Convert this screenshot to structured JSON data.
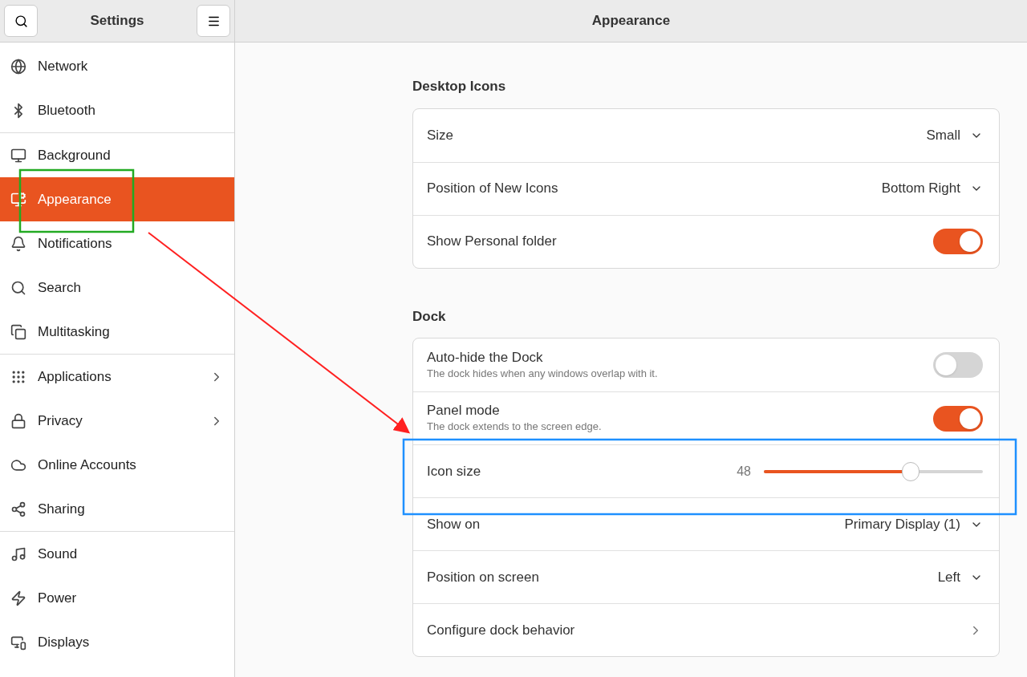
{
  "sidebar": {
    "title": "Settings",
    "groups": [
      {
        "items": [
          {
            "label": "Network",
            "selected": false,
            "submenu": false
          },
          {
            "label": "Bluetooth",
            "selected": false,
            "submenu": false
          }
        ]
      },
      {
        "items": [
          {
            "label": "Background",
            "selected": false,
            "submenu": false
          },
          {
            "label": "Appearance",
            "selected": true,
            "submenu": false
          },
          {
            "label": "Notifications",
            "selected": false,
            "submenu": false
          },
          {
            "label": "Search",
            "selected": false,
            "submenu": false
          },
          {
            "label": "Multitasking",
            "selected": false,
            "submenu": false
          }
        ]
      },
      {
        "items": [
          {
            "label": "Applications",
            "selected": false,
            "submenu": true
          },
          {
            "label": "Privacy",
            "selected": false,
            "submenu": true
          },
          {
            "label": "Online Accounts",
            "selected": false,
            "submenu": false
          },
          {
            "label": "Sharing",
            "selected": false,
            "submenu": false
          }
        ]
      },
      {
        "items": [
          {
            "label": "Sound",
            "selected": false,
            "submenu": false
          },
          {
            "label": "Power",
            "selected": false,
            "submenu": false
          },
          {
            "label": "Displays",
            "selected": false,
            "submenu": false
          }
        ]
      }
    ]
  },
  "main": {
    "title": "Appearance",
    "sections": [
      {
        "title": "Desktop Icons",
        "rows": [
          {
            "kind": "dropdown",
            "label": "Size",
            "value": "Small"
          },
          {
            "kind": "dropdown",
            "label": "Position of New Icons",
            "value": "Bottom Right"
          },
          {
            "kind": "switch",
            "label": "Show Personal folder",
            "on": true
          }
        ]
      },
      {
        "title": "Dock",
        "rows": [
          {
            "kind": "switch",
            "label": "Auto-hide the Dock",
            "subtitle": "The dock hides when any windows overlap with it.",
            "on": false
          },
          {
            "kind": "switch",
            "label": "Panel mode",
            "subtitle": "The dock extends to the screen edge.",
            "on": true
          },
          {
            "kind": "slider",
            "label": "Icon size",
            "reading": "48",
            "level": 0.67
          },
          {
            "kind": "dropdown",
            "label": "Show on",
            "value": "Primary Display (1)"
          },
          {
            "kind": "dropdown",
            "label": "Position on screen",
            "value": "Left"
          },
          {
            "kind": "link",
            "label": "Configure dock behavior"
          }
        ]
      }
    ]
  }
}
